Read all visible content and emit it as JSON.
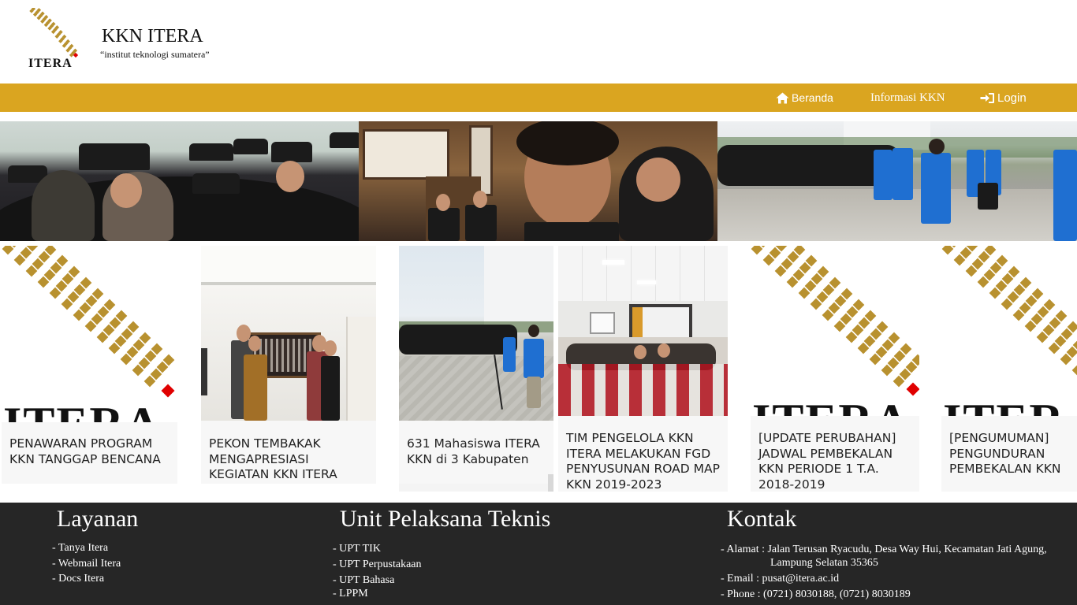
{
  "header": {
    "logo_word": "ITERA",
    "title": "KKN ITERA",
    "tagline": "“institut teknologi sumatera”"
  },
  "nav": {
    "beranda": "Beranda",
    "informasi": "Informasi KKN",
    "login": "Login"
  },
  "cards": [
    {
      "caption": "PENAWARAN PROGRAM KKN TANGGAP BENCANA",
      "image": "itera-logo",
      "logo_word": "ITERA"
    },
    {
      "caption": "PEKON TEMBAKAK MENGAPRESIASI KEGIATAN KKN ITERA",
      "image": "photo"
    },
    {
      "caption": "631 Mahasiswa ITERA KKN di 3 Kabupaten",
      "image": "photo"
    },
    {
      "caption": "TIM PENGELOLA KKN ITERA MELAKUKAN FGD PENYUSUNAN ROAD MAP KKN 2019-2023",
      "image": "photo"
    },
    {
      "caption": "[UPDATE PERUBAHAN] JADWAL PEMBEKALAN KKN PERIODE 1 T.A. 2018-2019",
      "image": "itera-logo",
      "logo_word": "ITERA"
    },
    {
      "caption": "[PENGUMUMAN] PENGUNDURAN PEMBEKALAN KKN",
      "image": "itera-logo",
      "logo_word": "ITER"
    }
  ],
  "footer": {
    "layanan": {
      "title": "Layanan",
      "links": [
        "- Tanya Itera",
        "- Webmail Itera",
        "- Docs Itera"
      ]
    },
    "upt": {
      "title": "Unit Pelaksana Teknis",
      "links": [
        "- UPT TIK",
        "- UPT Perpustakaan",
        "- UPT Bahasa",
        "- LPPM"
      ]
    },
    "kontak": {
      "title": "Kontak",
      "alamat_line1": "- Alamat : Jalan Terusan Ryacudu, Desa Way Hui, Kecamatan Jati Agung,",
      "alamat_line2": "Lampung Selatan 35365",
      "email": "- Email : pusat@itera.ac.id",
      "phone": "- Phone : (0721) 8030188, (0721) 8030189"
    }
  },
  "colors": {
    "accent": "#daa520",
    "logo_gold": "#b8912f",
    "logo_red": "#e00000",
    "footer_bg": "#262626"
  }
}
